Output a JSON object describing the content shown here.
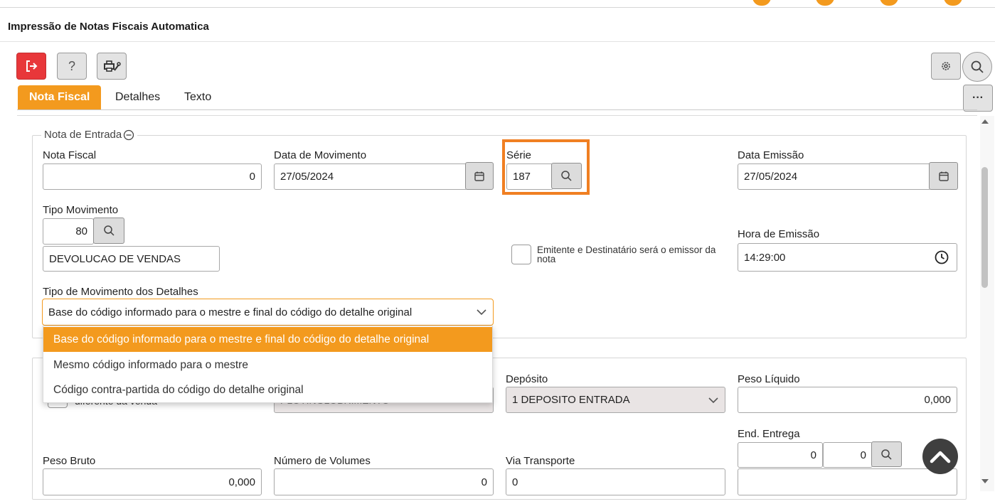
{
  "app": {
    "title": "Impressão de Notas Fiscais Automatica",
    "accent_color": "#f39a1e",
    "highlight_color": "#f07f22"
  },
  "toolbar": {
    "exit_icon": "exit-icon",
    "help_label": "?",
    "print_setup_icon": "printer-wrench-icon",
    "settings_icon": "gear-icon",
    "search_icon": "search-icon",
    "more_label": "···"
  },
  "tabs": [
    {
      "label": "Nota Fiscal",
      "active": true
    },
    {
      "label": "Detalhes",
      "active": false
    },
    {
      "label": "Texto",
      "active": false
    }
  ],
  "nota_entrada": {
    "legend": "Nota de Entrada",
    "nota_fiscal": {
      "label": "Nota Fiscal",
      "value": "0"
    },
    "data_movimento": {
      "label": "Data de Movimento",
      "value": "27/05/2024"
    },
    "serie": {
      "label": "Série",
      "value": "187"
    },
    "data_emissao": {
      "label": "Data Emissão",
      "value": "27/05/2024"
    },
    "tipo_movimento": {
      "label": "Tipo Movimento",
      "code": "80",
      "description": "DEVOLUCAO DE VENDAS"
    },
    "emitente_checkbox": {
      "label": "Emitente e Destinatário será o emissor da nota",
      "checked": false
    },
    "hora_emissao": {
      "label": "Hora de Emissão",
      "value": "14:29:00"
    },
    "tipo_mov_detalhes": {
      "label": "Tipo de Movimento dos Detalhes",
      "selected": "Base do código informado para o mestre e final do código do detalhe original",
      "options": [
        "Base do código informado para o mestre e final do código do detalhe original",
        "Mesmo código informado para o mestre",
        "Código contra-partida do código do detalhe original"
      ]
    }
  },
  "second_section": {
    "partial_check_label": "diferente da venda",
    "partial_field_text": "PLOTINGLOBRIMENTO",
    "deposito": {
      "label": "Depósito",
      "value": "1 DEPOSITO ENTRADA"
    },
    "peso_liquido": {
      "label": "Peso Líquido",
      "value": "0,000"
    },
    "end_entrega": {
      "label": "End. Entrega",
      "value1": "0",
      "value2": "0",
      "value3": ""
    },
    "peso_bruto": {
      "label": "Peso Bruto",
      "value": "0,000"
    },
    "numero_volumes": {
      "label": "Número de Volumes",
      "value": "0"
    },
    "via_transporte": {
      "label": "Via Transporte",
      "value": "0"
    }
  }
}
